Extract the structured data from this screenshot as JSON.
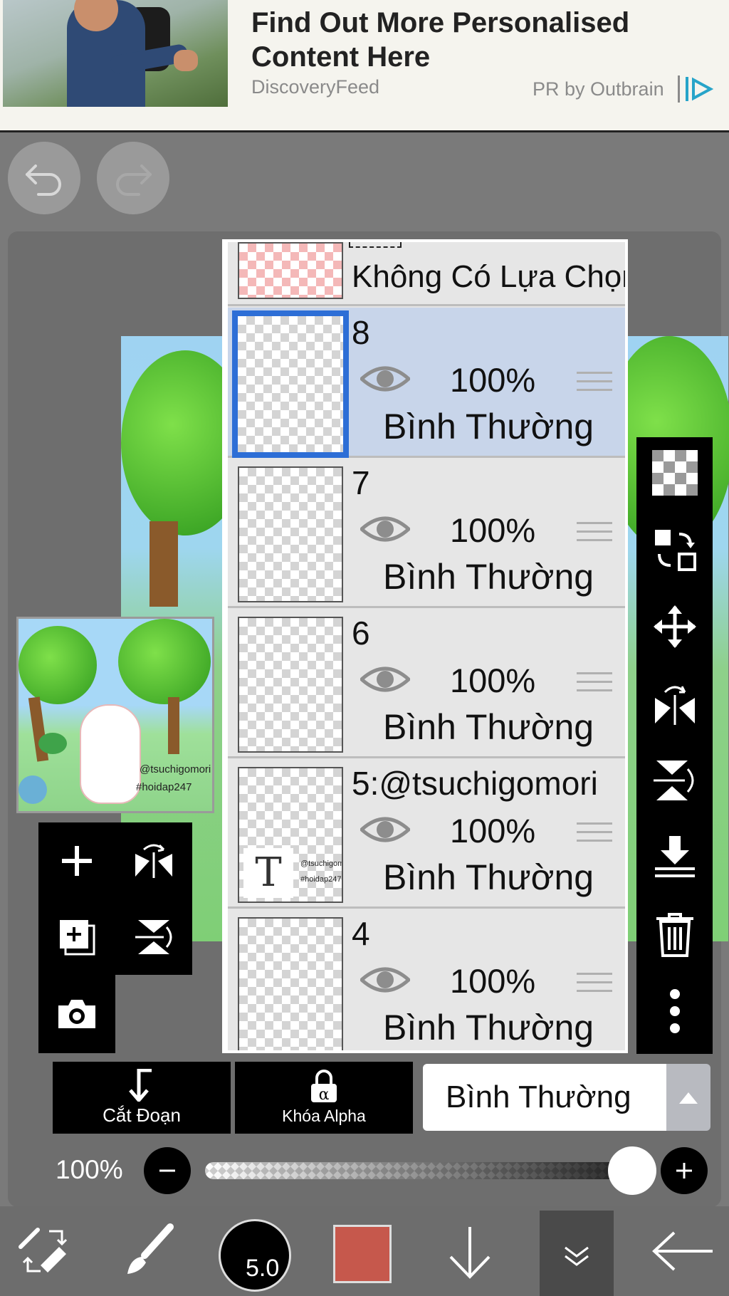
{
  "ad": {
    "title": "Find Out More Personalised Content Here",
    "source": "DiscoveryFeed",
    "sponsor": "PR by Outbrain",
    "logo_icon": "outbrain-logo-icon"
  },
  "history": {
    "undo_icon": "undo-icon",
    "redo_icon": "redo-icon"
  },
  "preview": {
    "text_line1": "@tsuchigomori",
    "text_line2": "#hoidap247"
  },
  "left_tools": [
    "add-layer-icon",
    "flip-horizontal-icon",
    "add-layer-copy-icon",
    "flip-vertical-icon",
    "camera-icon"
  ],
  "layer_panel": {
    "selection_label": "Không Có Lựa Chọn",
    "layers": [
      {
        "name": "8",
        "opacity": "100%",
        "blend": "Bình Thường",
        "selected": true
      },
      {
        "name": "7",
        "opacity": "100%",
        "blend": "Bình Thường",
        "selected": false
      },
      {
        "name": "6",
        "opacity": "100%",
        "blend": "Bình Thường",
        "selected": false
      },
      {
        "name": "5:@tsuchigomori",
        "opacity": "100%",
        "blend": "Bình Thường",
        "selected": false
      },
      {
        "name": "4",
        "opacity": "100%",
        "blend": "Bình Thường",
        "selected": false
      }
    ],
    "text_layer_thumb": {
      "glyph": "T",
      "line1": "@tsuchigom",
      "line2": "#hoidap247"
    }
  },
  "right_tools": [
    "transparent-bg-icon",
    "select-layer-icon",
    "move-icon",
    "flip-h-icon",
    "flip-v-icon",
    "merge-down-icon",
    "trash-icon",
    "more-icon"
  ],
  "actions": {
    "clipping_label": "Cắt Đoạn",
    "alpha_lock_label": "Khóa Alpha",
    "blend_mode": "Bình Thường"
  },
  "opacity": {
    "label": "100%",
    "value": 1.0
  },
  "bottom_bar": {
    "brush_size": "5.0",
    "color": "#c6584c"
  }
}
